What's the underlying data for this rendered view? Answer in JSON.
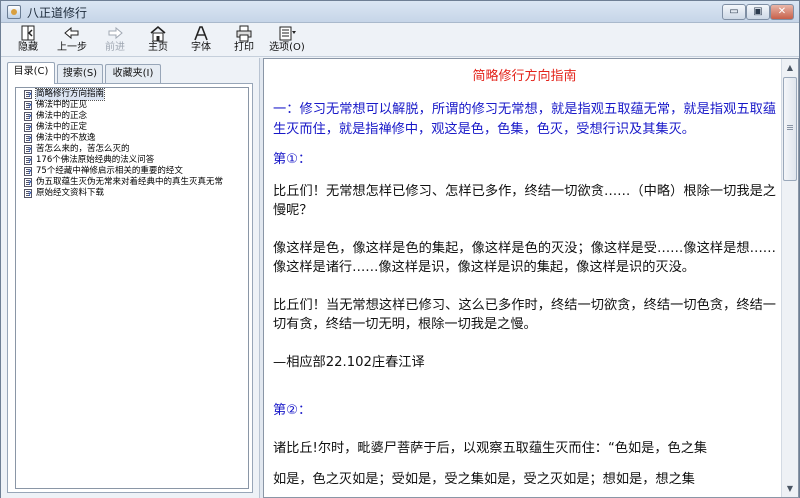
{
  "window": {
    "title": "八正道修行",
    "controls": {
      "minimize": "▭",
      "maximize": "▣",
      "close": "✕"
    }
  },
  "toolbar": {
    "hide": {
      "label": "隐藏",
      "icon": "hide-pane-icon"
    },
    "back": {
      "label": "上一步",
      "icon": "back-arrow-icon"
    },
    "forward": {
      "label": "前进",
      "icon": "forward-arrow-icon",
      "disabled": true
    },
    "home": {
      "label": "主页",
      "icon": "home-icon"
    },
    "font": {
      "label": "字体",
      "icon": "font-icon"
    },
    "print": {
      "label": "打印",
      "icon": "printer-icon"
    },
    "options": {
      "label": "选项(O)",
      "icon": "options-icon"
    }
  },
  "nav_tabs": {
    "contents": "目录(C)",
    "search": "搜索(S)",
    "favorites": "收藏夹(I)"
  },
  "tree": {
    "items": [
      "简略修行方向指南",
      "佛法中的正见",
      "佛法中的正念",
      "佛法中的正定",
      "佛法中的不放逸",
      "苦怎么来的，苦怎么灭的",
      "176个佛法原始经典的法义问答",
      "75个经藏中禅修启示相关的重要的经文",
      "伪五取蕴生灭伪无常来对着经典中的真生灭真无常",
      "原始经文资料下载"
    ],
    "selected_index": 0
  },
  "document": {
    "title": "简略修行方向指南",
    "intro": "一：修习无常想可以解脱，所谓的修习无常想，就是指观五取蕴无常，就是指观五取蕴生灭而住，就是指禅修中，观这是色，色集，色灭，受想行识及其集灭。",
    "section1": "第①：",
    "p1": "比丘们！无常想怎样已修习、怎样已多作，终结一切欲贪……（中略）根除一切我是之慢呢？",
    "p2": "像这样是色，像这样是色的集起，像这样是色的灭没；像这样是受……像这样是想……像这样是诸行……像这样是识，像这样是识的集起，像这样是识的灭没。",
    "p3": "比丘们！当无常想这样已修习、这么已多作时，终结一切欲贪，终结一切色贪，终结一切有贪，终结一切无明，根除一切我是之慢。",
    "source": "—相应部22.102庄春江译",
    "section2": "第②：",
    "p4": "诸比丘!尔时，毗婆尸菩萨于后，以观察五取蕴生灭而住：“色如是，色之集",
    "p5": "如是，色之灭如是；受如是，受之集如是，受之灭如是；想如是，想之集"
  },
  "colors": {
    "title_red": "#e3231a",
    "highlight_blue": "#1818c8"
  }
}
